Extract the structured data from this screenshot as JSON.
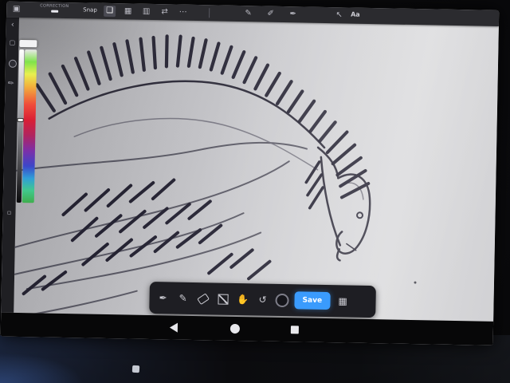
{
  "top_toolbar": {
    "correction_label": "CORRECTION",
    "snap_label": "Snap",
    "text_tool_label": "Aa"
  },
  "bottom_toolbar": {
    "save_label": "Save"
  },
  "icons": {
    "menu": "▣",
    "image": "❏",
    "grid": "▦",
    "layout": "▥",
    "flip": "⇄",
    "more": "⋯",
    "pen": "✎",
    "marker": "✐",
    "ink_pen": "✒",
    "pointer": "↖",
    "chevron_left": "‹",
    "select_square": "▢",
    "side_pen": "✎",
    "small_square": "▫",
    "dock_pen": "✒",
    "dock_pencil": "✎",
    "hand": "✋",
    "undo": "↺",
    "keypad": "▦"
  },
  "colors": {
    "accent_blue": "#3a9bfd",
    "ink": "#262434",
    "canvas_gray": "#c9c9cd",
    "toolbar_gray": "#2b2b2f"
  }
}
